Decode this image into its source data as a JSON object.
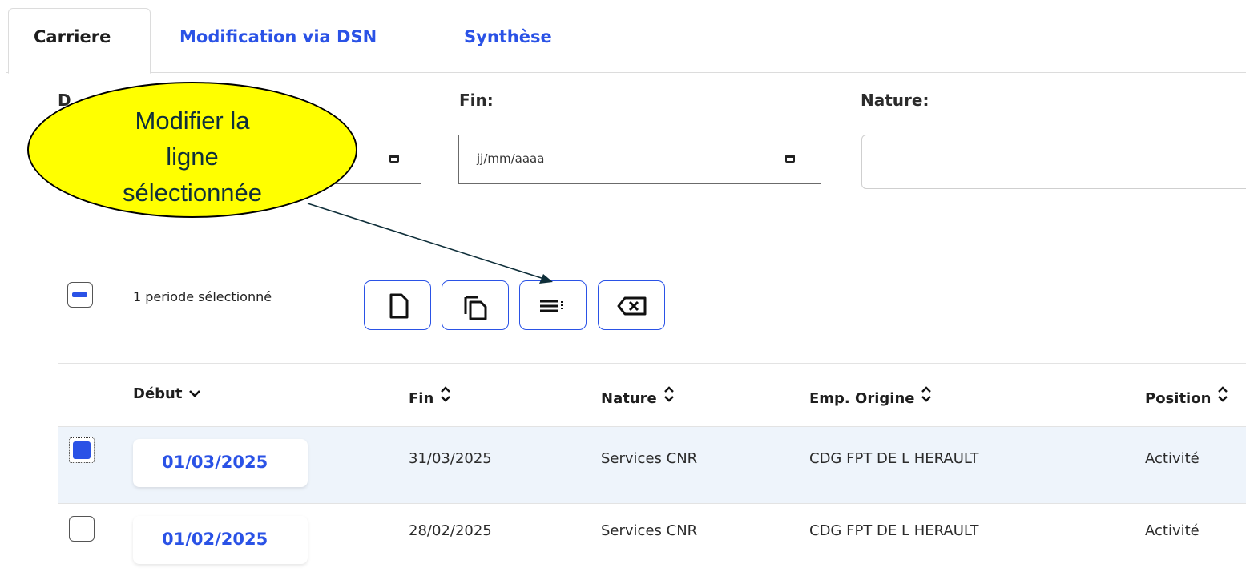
{
  "tabs": [
    {
      "label": "Carriere"
    },
    {
      "label": "Modification via DSN"
    },
    {
      "label": "Synthèse"
    }
  ],
  "filters": {
    "debut_label": "D",
    "fin_label": "Fin:",
    "fin_placeholder": "jj/mm/aaaa",
    "nature_label": "Nature:",
    "nature_value": ""
  },
  "callout": {
    "text": "Modifier la\nligne\nsélectionnée",
    "fill_color": "#ffff00"
  },
  "toolbar": {
    "selection_text": "1 periode sélectionné",
    "buttons": [
      {
        "icon": "new-document-icon"
      },
      {
        "icon": "copy-icon"
      },
      {
        "icon": "edit-list-icon"
      },
      {
        "icon": "delete-backspace-icon"
      }
    ]
  },
  "table": {
    "columns": [
      {
        "label": "Début",
        "sort_icon": "chevron-down-icon"
      },
      {
        "label": "Fin",
        "sort_icon": "sort-icon"
      },
      {
        "label": "Nature",
        "sort_icon": "sort-icon"
      },
      {
        "label": "Emp. Origine",
        "sort_icon": "sort-icon"
      },
      {
        "label": "Position",
        "sort_icon": "sort-icon"
      }
    ],
    "rows": [
      {
        "selected": true,
        "debut": "01/03/2025",
        "fin": "31/03/2025",
        "nature": "Services CNR",
        "emp_origine": "CDG FPT DE L HERAULT",
        "position": "Activité"
      },
      {
        "selected": false,
        "debut": "01/02/2025",
        "fin": "28/02/2025",
        "nature": "Services CNR",
        "emp_origine": "CDG FPT DE L HERAULT",
        "position": "Activité"
      }
    ]
  },
  "colors": {
    "accent": "#2a52e6",
    "selected_row": "#eef4fb"
  }
}
